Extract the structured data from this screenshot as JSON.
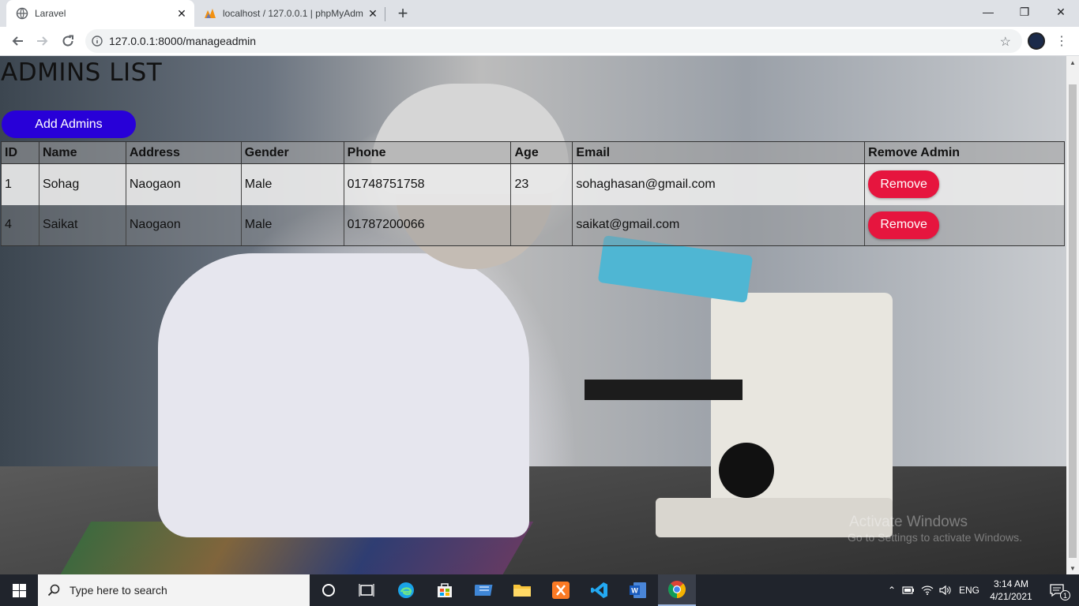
{
  "browser": {
    "tabs": [
      {
        "title": "Laravel",
        "active": true
      },
      {
        "title": "localhost / 127.0.0.1 | phpMyAdm",
        "active": false
      }
    ],
    "url": "127.0.0.1:8000/manageadmin"
  },
  "page": {
    "title": "ADMINS LIST",
    "add_button_label": "Add Admins",
    "table": {
      "headers": [
        "ID",
        "Name",
        "Address",
        "Gender",
        "Phone",
        "Age",
        "Email",
        "Remove Admin"
      ],
      "rows": [
        {
          "id": "1",
          "name": "Sohag",
          "address": "Naogaon",
          "gender": "Male",
          "phone": "01748751758",
          "age": "23",
          "email": "sohaghasan@gmail.com",
          "action": "Remove"
        },
        {
          "id": "4",
          "name": "Saikat",
          "address": "Naogaon",
          "gender": "Male",
          "phone": "01787200066",
          "age": "",
          "email": "saikat@gmail.com",
          "action": "Remove"
        }
      ]
    }
  },
  "watermark": {
    "title": "Activate Windows",
    "subtitle": "Go to Settings to activate Windows."
  },
  "taskbar": {
    "search_placeholder": "Type here to search",
    "language": "ENG",
    "time": "3:14 AM",
    "date": "4/21/2021",
    "notification_count": "1"
  },
  "colors": {
    "add_button": "#2800d8",
    "remove_button": "#e6153e"
  }
}
